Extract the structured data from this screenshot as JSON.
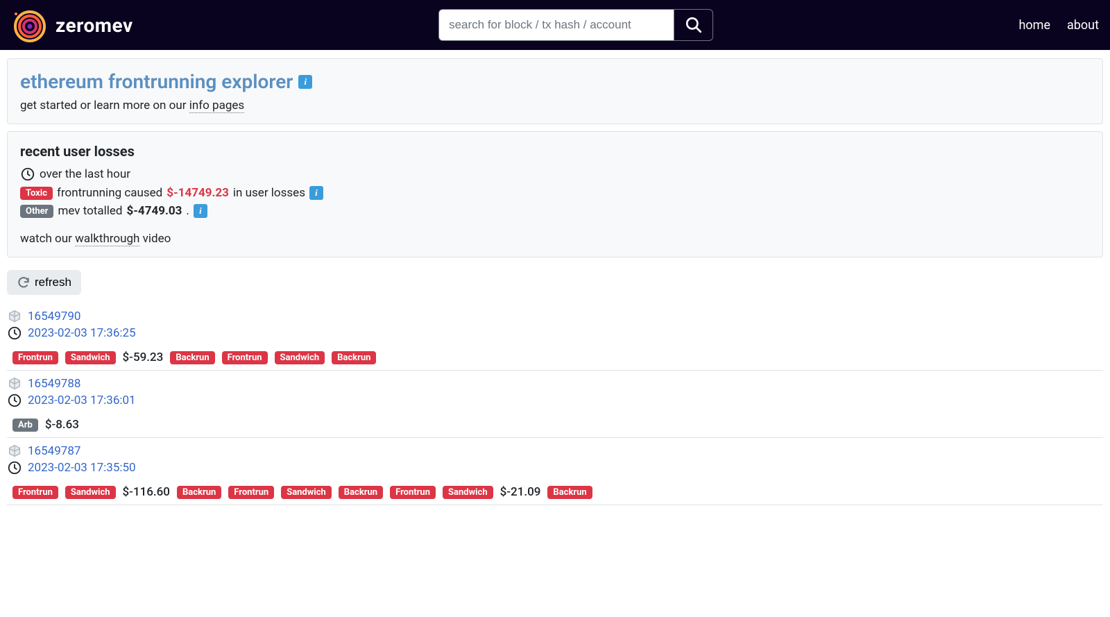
{
  "nav": {
    "brand": "zeromev",
    "search_placeholder": "search for block / tx hash / account",
    "links": {
      "home": "home",
      "about": "about"
    }
  },
  "intro": {
    "title": "ethereum frontrunning explorer",
    "subtext_prefix": "get started or learn more on our ",
    "subtext_link": "info pages"
  },
  "summary": {
    "title": "recent user losses",
    "over_last_hour": "over the last hour",
    "toxic_badge": "Toxic",
    "toxic_text_pre": "frontrunning caused ",
    "toxic_amount": "$-14749.23",
    "toxic_text_post": " in user losses",
    "other_badge": "Other",
    "other_text_pre": "mev totalled ",
    "other_amount": "$-4749.03",
    "other_text_post": ".",
    "walkthrough_pre": "watch our ",
    "walkthrough_link": "walkthrough",
    "walkthrough_post": " video"
  },
  "refresh_label": "refresh",
  "labels": {
    "frontrun": "Frontrun",
    "sandwich": "Sandwich",
    "backrun": "Backrun",
    "arb": "Arb"
  },
  "blocks": [
    {
      "number": "16549790",
      "time": "2023-02-03 17:36:25",
      "items": [
        {
          "type": "tag",
          "style": "red",
          "key": "frontrun"
        },
        {
          "type": "tag",
          "style": "red",
          "key": "sandwich"
        },
        {
          "type": "amount",
          "value": "$-59.23"
        },
        {
          "type": "tag",
          "style": "red",
          "key": "backrun"
        },
        {
          "type": "tag",
          "style": "red",
          "key": "frontrun"
        },
        {
          "type": "tag",
          "style": "red",
          "key": "sandwich"
        },
        {
          "type": "tag",
          "style": "red",
          "key": "backrun"
        }
      ]
    },
    {
      "number": "16549788",
      "time": "2023-02-03 17:36:01",
      "items": [
        {
          "type": "tag",
          "style": "grey",
          "key": "arb"
        },
        {
          "type": "amount",
          "value": "$-8.63"
        }
      ]
    },
    {
      "number": "16549787",
      "time": "2023-02-03 17:35:50",
      "items": [
        {
          "type": "tag",
          "style": "red",
          "key": "frontrun"
        },
        {
          "type": "tag",
          "style": "red",
          "key": "sandwich"
        },
        {
          "type": "amount",
          "value": "$-116.60"
        },
        {
          "type": "tag",
          "style": "red",
          "key": "backrun"
        },
        {
          "type": "tag",
          "style": "red",
          "key": "frontrun"
        },
        {
          "type": "tag",
          "style": "red",
          "key": "sandwich"
        },
        {
          "type": "tag",
          "style": "red",
          "key": "backrun"
        },
        {
          "type": "tag",
          "style": "red",
          "key": "frontrun"
        },
        {
          "type": "tag",
          "style": "red",
          "key": "sandwich"
        },
        {
          "type": "amount",
          "value": "$-21.09"
        },
        {
          "type": "tag",
          "style": "red",
          "key": "backrun"
        }
      ]
    }
  ]
}
